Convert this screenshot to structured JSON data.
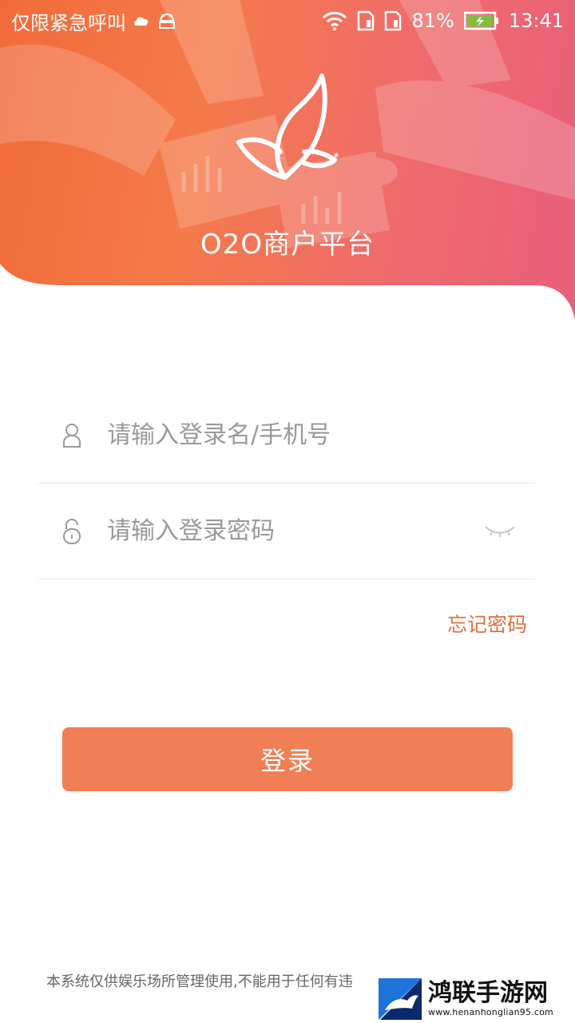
{
  "status_bar": {
    "carrier": "仅限紧急呼叫",
    "battery_percent": "81%",
    "time": "13:41",
    "icons": [
      "cloud-weather-icon",
      "android-debug-icon",
      "wifi-icon",
      "sim1-icon",
      "sim2-icon",
      "battery-charging-icon"
    ]
  },
  "header": {
    "logo": "butterfly-logo-icon",
    "title": "O2O商户平台"
  },
  "form": {
    "username": {
      "icon": "user-icon",
      "placeholder": "请输入登录名/手机号",
      "value": ""
    },
    "password": {
      "icon": "lock-icon",
      "placeholder": "请输入登录密码",
      "value": "",
      "toggle_icon": "eye-closed-icon"
    },
    "forgot_label": "忘记密码",
    "login_label": "登录"
  },
  "footer": {
    "notice": "本系统仅供娱乐场所管理使用,不能用于任何有违"
  },
  "watermark": {
    "name": "鸿联手游网",
    "url": "www.henanhonglian95.com"
  },
  "colors": {
    "accent": "#f17f55",
    "forgot": "#e0703c",
    "banner_start": "#f26a3a",
    "banner_end": "#e95f7a"
  }
}
